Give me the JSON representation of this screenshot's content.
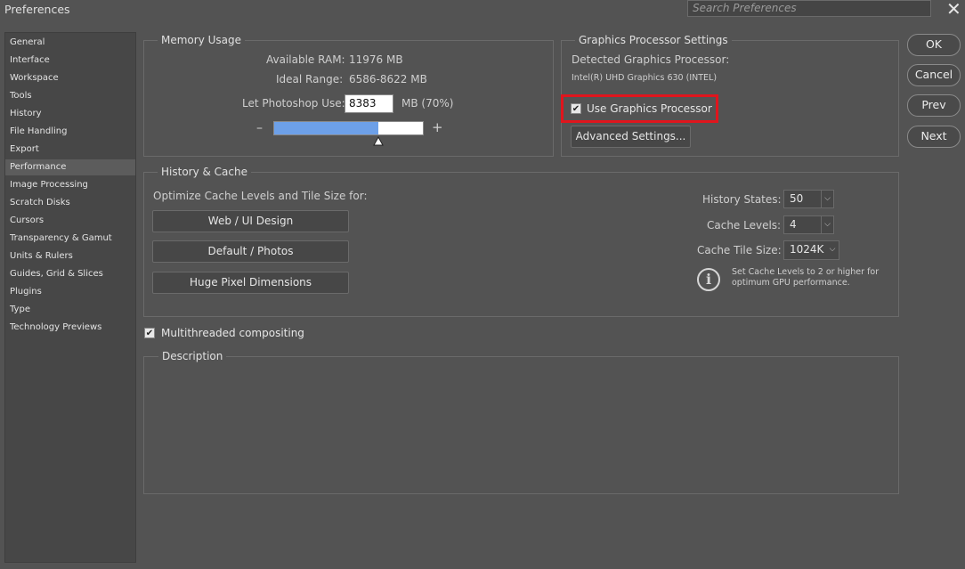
{
  "window": {
    "title": "Preferences",
    "search_placeholder": "Search Preferences",
    "close_glyph": "✕"
  },
  "sidebar": {
    "items": [
      {
        "label": "General"
      },
      {
        "label": "Interface"
      },
      {
        "label": "Workspace"
      },
      {
        "label": "Tools"
      },
      {
        "label": "History"
      },
      {
        "label": "File Handling"
      },
      {
        "label": "Export"
      },
      {
        "label": "Performance",
        "active": true
      },
      {
        "label": "Image Processing"
      },
      {
        "label": "Scratch Disks"
      },
      {
        "label": "Cursors"
      },
      {
        "label": "Transparency & Gamut"
      },
      {
        "label": "Units & Rulers"
      },
      {
        "label": "Guides, Grid & Slices"
      },
      {
        "label": "Plugins"
      },
      {
        "label": "Type"
      },
      {
        "label": "Technology Previews"
      }
    ]
  },
  "memory": {
    "legend": "Memory Usage",
    "available_label": "Available RAM:",
    "available_value": "11976 MB",
    "ideal_label": "Ideal Range:",
    "ideal_value": "6586-8622 MB",
    "use_label": "Let Photoshop Use:",
    "use_value": "8383",
    "use_unit": "MB (70%)",
    "minus": "–",
    "plus": "+",
    "slider_fraction": 0.7
  },
  "gpu": {
    "legend": "Graphics Processor Settings",
    "detected_label": "Detected Graphics Processor:",
    "detected_value": "Intel(R) UHD Graphics 630 (INTEL)",
    "use_gpu_label": "Use Graphics Processor",
    "use_gpu_checked": true,
    "advanced_label": "Advanced Settings..."
  },
  "history_cache": {
    "legend": "History & Cache",
    "optimize_label": "Optimize Cache Levels and Tile Size for:",
    "buttons": [
      "Web / UI Design",
      "Default / Photos",
      "Huge Pixel Dimensions"
    ],
    "history_states_label": "History States:",
    "history_states_value": "50",
    "cache_levels_label": "Cache Levels:",
    "cache_levels_value": "4",
    "tile_size_label": "Cache Tile Size:",
    "tile_size_value": "1024K",
    "info_line1": "Set Cache Levels to 2 or higher for",
    "info_line2": "optimum GPU performance."
  },
  "multithreaded": {
    "label": "Multithreaded compositing",
    "checked": true
  },
  "description": {
    "legend": "Description"
  },
  "actions": {
    "ok": "OK",
    "cancel": "Cancel",
    "prev": "Prev",
    "next": "Next"
  },
  "icons": {
    "checkmark": "✔",
    "info": "i",
    "chevron": "⌵",
    "highlight_color": "#e0151d",
    "slider_color": "#6da0e8"
  }
}
